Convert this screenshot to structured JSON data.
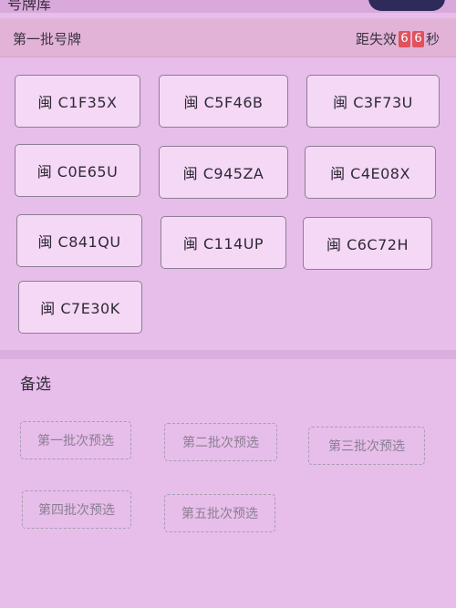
{
  "topbar": {
    "title": "号牌库"
  },
  "header": {
    "title": "第一批号牌",
    "countdown_prefix": "距失效",
    "countdown_digits": [
      "6",
      "6"
    ],
    "countdown_suffix": "秒"
  },
  "plates": [
    "闽 C1F35X",
    "闽 C5F46B",
    "闽 C3F73U",
    "闽 C0E65U",
    "闽 C945ZA",
    "闽 C4E08X",
    "闽 C841QU",
    "闽 C114UP",
    "闽 C6C72H",
    "闽 C7E30K"
  ],
  "alternates": {
    "title": "备选",
    "items": [
      "第一批次预选",
      "第二批次预选",
      "第三批次预选",
      "第四批次预选",
      "第五批次预选"
    ]
  }
}
